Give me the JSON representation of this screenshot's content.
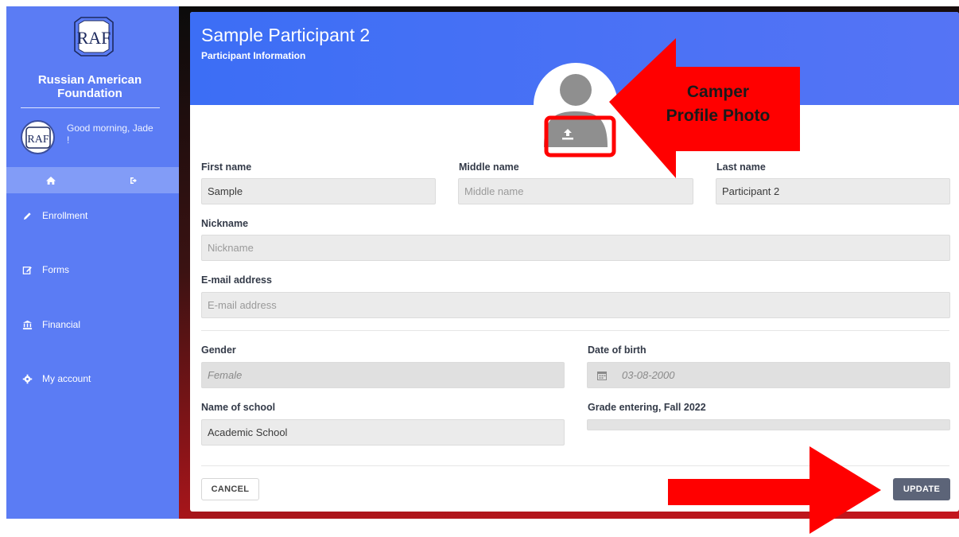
{
  "sidebar": {
    "org_name_line1": "Russian American",
    "org_name_line2": "Foundation",
    "greeting_line1": "Good morning, Jade",
    "greeting_line2": "!",
    "nav": [
      {
        "label": "Enrollment",
        "icon": "pencil-icon"
      },
      {
        "label": "Forms",
        "icon": "edit-icon"
      },
      {
        "label": "Financial",
        "icon": "bank-icon"
      },
      {
        "label": "My account",
        "icon": "gear-icon"
      }
    ],
    "colors": {
      "bg": "#5b7cf4",
      "highlight": "#829cf7"
    }
  },
  "header": {
    "title": "Sample Participant 2",
    "subtitle": "Participant Information"
  },
  "form": {
    "first_name": {
      "label": "First name",
      "value": "Sample"
    },
    "middle_name": {
      "label": "Middle name",
      "placeholder": "Middle name"
    },
    "last_name": {
      "label": "Last name",
      "value": "Participant 2"
    },
    "nickname": {
      "label": "Nickname",
      "placeholder": "Nickname"
    },
    "email": {
      "label": "E-mail address",
      "placeholder": "E-mail address"
    },
    "gender": {
      "label": "Gender",
      "value": "Female"
    },
    "dob": {
      "label": "Date of birth",
      "value": "03-08-2000"
    },
    "school": {
      "label": "Name of school",
      "value": "Academic School"
    },
    "grade": {
      "label": "Grade entering, Fall 2022",
      "value": ""
    }
  },
  "buttons": {
    "cancel": "CANCEL",
    "update": "UPDATE"
  },
  "annotations": {
    "callout_line1": "Camper",
    "callout_line2": "Profile Photo",
    "color": "#ff0000"
  }
}
